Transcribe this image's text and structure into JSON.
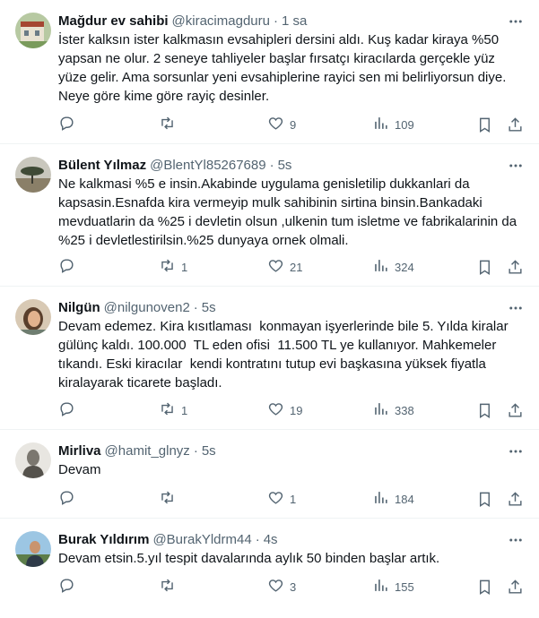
{
  "tweets": [
    {
      "name": "Mağdur ev sahibi",
      "handle": "@kiracimagduru",
      "time": "1 sa",
      "text": "İster kalksın ister kalkmasın evsahipleri dersini aldı. Kuş kadar kiraya %50 yapsan ne olur. 2 seneye tahliyeler başlar fırsatçı kiracılarda gerçekle yüz yüze gelir. Ama sorsunlar yeni evsahiplerine rayici sen mi belirliyorsun diye. Neye göre kime göre rayiç desinler.",
      "replies": "",
      "retweets": "",
      "likes": "9",
      "views": "109"
    },
    {
      "name": "Bülent Yılmaz",
      "handle": "@BlentYl85267689",
      "time": "5s",
      "text": "Ne kalkmasi %5 e insin.Akabinde uygulama genisletilip dukkanlari da kapsasin.Esnafda kira vermeyip mulk sahibinin sirtina binsin.Bankadaki mevduatlarin da %25 i devletin olsun ,ulkenin tum isletme ve fabrikalarinin da %25 i devletlestirilsin.%25 dunyaya ornek olmali.",
      "replies": "",
      "retweets": "1",
      "likes": "21",
      "views": "324"
    },
    {
      "name": "Nilgün",
      "handle": "@nilgunoven2",
      "time": "5s",
      "text": "Devam edemez. Kira kısıtlaması  konmayan işyerlerinde bile 5. Yılda kiralar gülünç kaldı. 100.000  TL eden ofisi  11.500 TL ye kullanıyor. Mahkemeler tıkandı. Eski kiracılar  kendi kontratını tutup evi başkasına yüksek fiyatla kiralayarak ticarete başladı.",
      "replies": "",
      "retweets": "1",
      "likes": "19",
      "views": "338"
    },
    {
      "name": "Mirliva",
      "handle": "@hamit_glnyz",
      "time": "5s",
      "text": "Devam",
      "replies": "",
      "retweets": "",
      "likes": "1",
      "views": "184"
    },
    {
      "name": "Burak Yıldırım",
      "handle": "@BurakYldrm44",
      "time": "4s",
      "text": "Devam etsin.5.yıl tespit davalarında aylık 50 binden başlar artık.",
      "replies": "",
      "retweets": "",
      "likes": "3",
      "views": "155"
    }
  ],
  "separator": "·",
  "icons": {
    "more": "more-horizontal-icon",
    "reply": "reply-icon",
    "retweet": "retweet-icon",
    "like": "heart-icon",
    "views": "analytics-icon",
    "bookmark": "bookmark-icon",
    "share": "share-icon"
  },
  "colors": {
    "text": "#0f1419",
    "muted": "#536471",
    "border": "#eff3f4"
  }
}
